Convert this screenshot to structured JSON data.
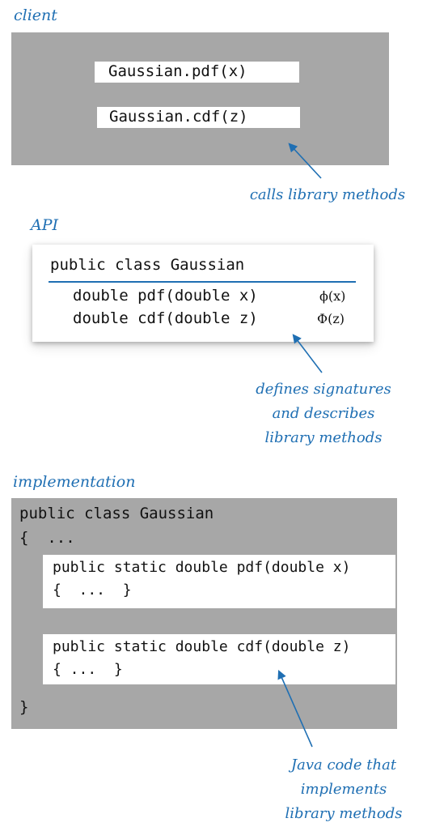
{
  "client": {
    "label": "client",
    "calls": [
      "Gaussian.pdf(x)",
      "Gaussian.cdf(z)"
    ],
    "annotation": "calls library methods"
  },
  "api": {
    "label": "API",
    "header": "public class Gaussian",
    "rows": [
      {
        "signature": "double pdf(double x)",
        "math": "ϕ(x)"
      },
      {
        "signature": "double cdf(double z)",
        "math": "Φ(z)"
      }
    ],
    "annotation": [
      "defines signatures",
      "and describes",
      "library methods"
    ]
  },
  "implementation": {
    "label": "implementation",
    "class_line": "public class Gaussian",
    "open_line": "{  ...",
    "methods": [
      {
        "header": "public static double pdf(double x)",
        "body": "{  ...  }"
      },
      {
        "header": "public static double cdf(double z)",
        "body": "{ ...  }"
      }
    ],
    "close_line": "}",
    "annotation": [
      "Java code that",
      "implements",
      "library methods"
    ]
  },
  "colors": {
    "accent": "#1f6fb3",
    "panel": "#a7a7a7"
  }
}
